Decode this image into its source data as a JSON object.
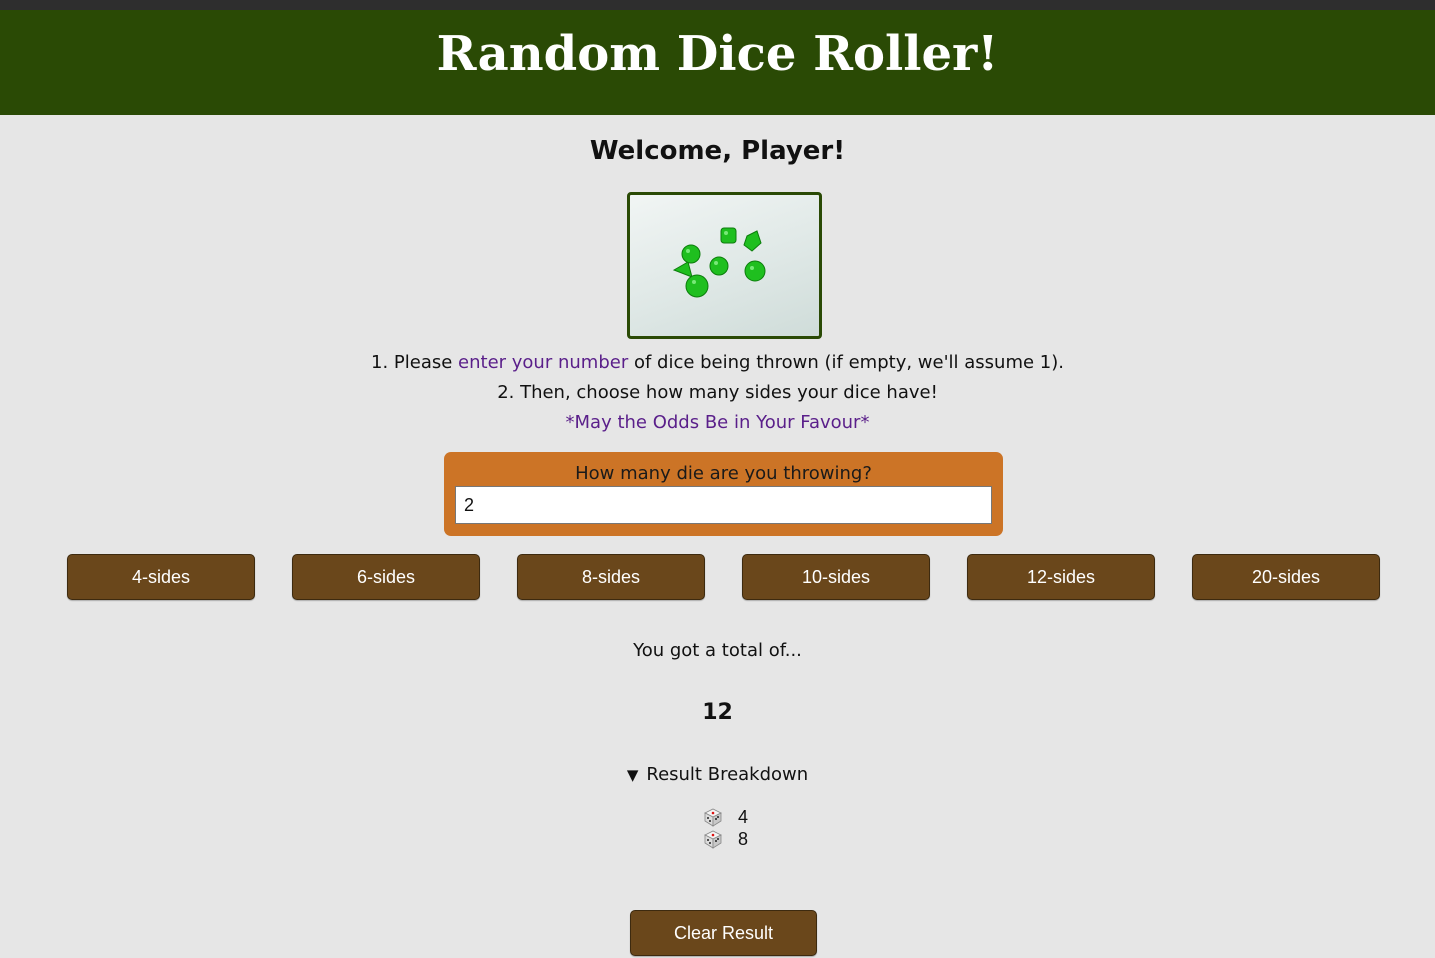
{
  "header": {
    "title": "Random Dice Roller!"
  },
  "welcome": "Welcome, Player!",
  "hero": {
    "icon": "dice-photo-icon"
  },
  "instructions": {
    "line1_prefix": "1. Please ",
    "line1_highlight": "enter your number",
    "line1_suffix": " of dice being thrown (if empty, we'll assume 1).",
    "line2": "2. Then, choose how many sides your dice have!",
    "line3": "*May the Odds Be in Your Favour*"
  },
  "dice_input": {
    "label": "How many die are you throwing?",
    "value": "2"
  },
  "sides_buttons": [
    {
      "label": "4-sides"
    },
    {
      "label": "6-sides"
    },
    {
      "label": "8-sides"
    },
    {
      "label": "10-sides"
    },
    {
      "label": "12-sides"
    },
    {
      "label": "20-sides"
    }
  ],
  "result": {
    "total_label": "You got a total of...",
    "total_value": "12",
    "breakdown_label": "Result Breakdown",
    "rolls": [
      "4",
      "8"
    ]
  },
  "clear_button": {
    "label": "Clear Result"
  },
  "colors": {
    "header_bg": "#2a4a05",
    "page_bg": "#e6e6e6",
    "card_bg": "#cc7426",
    "button_bg": "#6a471b",
    "accent_text": "#5a1f8a"
  }
}
